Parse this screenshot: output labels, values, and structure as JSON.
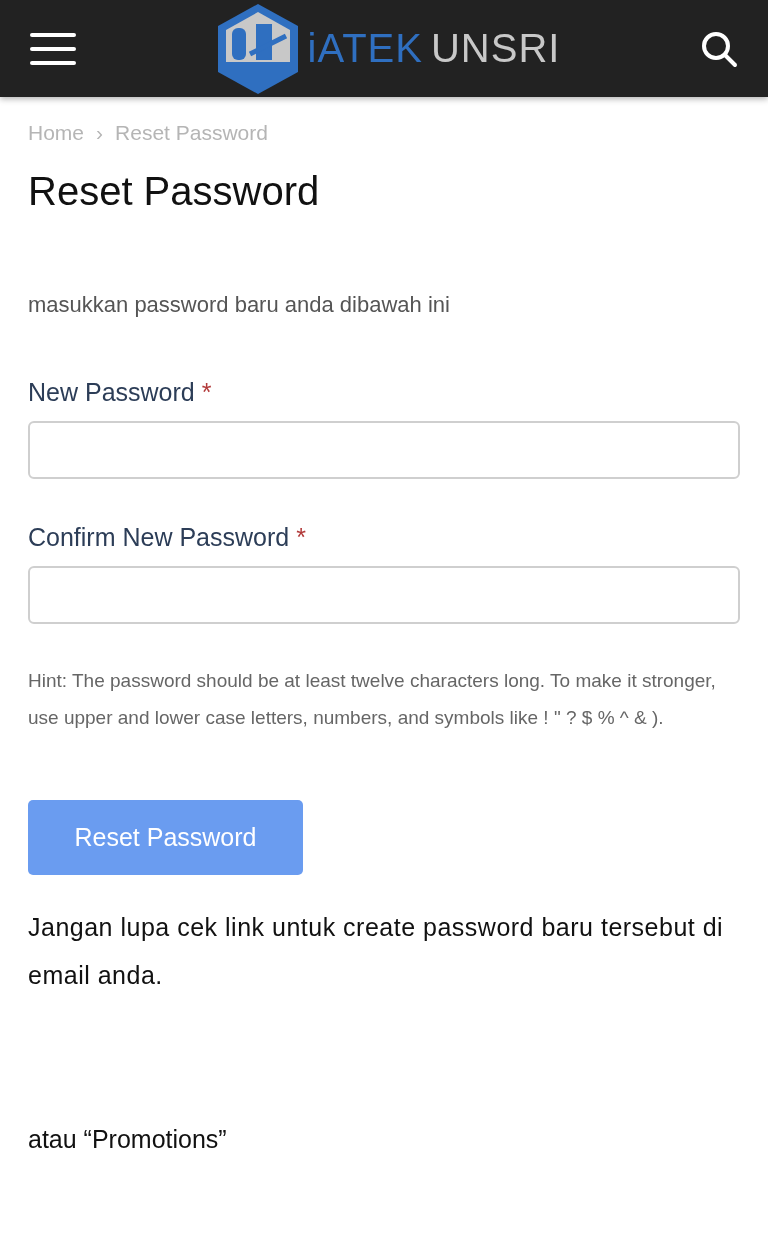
{
  "header": {
    "logo": {
      "primary": "iATEK",
      "secondary": "UNSRI"
    }
  },
  "breadcrumb": [
    {
      "label": "Home"
    },
    {
      "label": "Reset Password"
    }
  ],
  "breadcrumb_separator": "›",
  "title": "Reset Password",
  "intro": "masukkan password baru anda dibawah ini",
  "fields": [
    {
      "label": "New Password",
      "required_mark": "*"
    },
    {
      "label": "Confirm New Password",
      "required_mark": "*"
    }
  ],
  "hint": "Hint: The password should be at least twelve characters long. To make it stronger, use upper and lower case letters, numbers, and symbols like ! \" ? $ % ^ & ).",
  "submit": "Reset Password",
  "note": "Jangan lupa cek link untuk create password baru tersebut di email anda.",
  "footer_text": "atau “Promotions”"
}
